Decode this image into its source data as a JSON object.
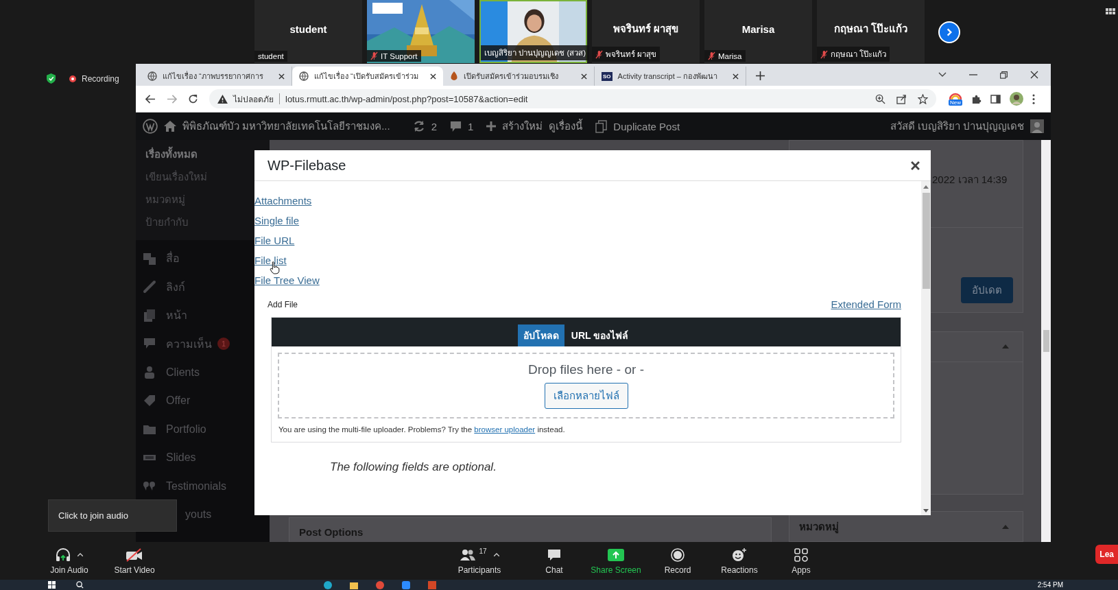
{
  "meeting": {
    "participants": [
      {
        "kind": "name",
        "name": "student",
        "label": "student",
        "muted": false
      },
      {
        "kind": "picture",
        "label": "IT Support",
        "muted": true
      },
      {
        "kind": "video",
        "label": "เบญสิริยา ปานปุญญเดช (สวส)",
        "muted": false
      },
      {
        "kind": "name",
        "name": "พจรินทร์ ผาสุข",
        "label": "พจรินทร์ ผาสุข",
        "muted": true
      },
      {
        "kind": "name",
        "name": "Marisa",
        "label": "Marisa",
        "muted": true
      },
      {
        "kind": "name",
        "name": "กฤษณา โป๊ะแก้ว",
        "label": "กฤษณา โป๊ะแก้ว",
        "muted": true
      }
    ],
    "recording": "Recording",
    "tooltip": "Click to join audio",
    "toolbar": [
      {
        "kind": "audio",
        "label": "Join Audio"
      },
      {
        "kind": "video",
        "label": "Start Video"
      },
      {
        "kind": "participants",
        "label": "Participants",
        "count": "17"
      },
      {
        "kind": "chat",
        "label": "Chat"
      },
      {
        "kind": "share",
        "label": "Share Screen"
      },
      {
        "kind": "record",
        "label": "Record"
      },
      {
        "kind": "reactions",
        "label": "Reactions"
      },
      {
        "kind": "apps",
        "label": "Apps"
      }
    ],
    "leave": "Lea"
  },
  "browser": {
    "tabs": [
      {
        "kind": "globe",
        "title": "แก้ไขเรื่อง “ภาพบรรยากาศการ",
        "selected": false
      },
      {
        "kind": "globe",
        "title": "แก้ไขเรื่อง “เปิดรับสมัครเข้าร่วม",
        "selected": true
      },
      {
        "kind": "drop",
        "title": "เปิดรับสมัครเข้าร่วมอบรมเชิง",
        "selected": false
      },
      {
        "kind": "badge",
        "favicon": "SO",
        "title": "Activity transcript – กองพัฒนา",
        "selected": false
      }
    ],
    "security": "ไม่ปลอดภัย",
    "url": "lotus.rmutt.ac.th/wp-admin/post.php?post=10587&action=edit",
    "extension_badge": "New"
  },
  "admin_bar": {
    "site": "พิพิธภัณฑ์บัว มหาวิทยาลัยเทคโนโลยีราชมงค...",
    "updates": "2",
    "comments": "1",
    "new": "สร้างใหม่",
    "view": "ดูเรื่องนี้",
    "duplicate": "Duplicate Post",
    "greeting": "สวัสดี เบญสิริยา ปานปุญญเดช"
  },
  "sidebar": {
    "submenu": [
      {
        "label": "เรื่องทั้งหมด",
        "selected": true
      },
      {
        "label": "เขียนเรื่องใหม่",
        "selected": false
      },
      {
        "label": "หมวดหมู่",
        "selected": false
      },
      {
        "label": "ป้ายกำกับ",
        "selected": false
      }
    ],
    "menu": [
      {
        "label": "สื่อ"
      },
      {
        "label": "ลิงก์"
      },
      {
        "label": "หน้า"
      },
      {
        "label": "ความเห็น",
        "badge": "1"
      },
      {
        "label": "Clients"
      },
      {
        "label": "Offer"
      },
      {
        "label": "Portfolio"
      },
      {
        "label": "Slides"
      },
      {
        "label": "Testimonials"
      },
      {
        "label": "youts"
      }
    ]
  },
  "editor": {
    "publish_date": "2022 เวลา 14:39",
    "update_button": "อัปเดต",
    "post_options": "Post Options",
    "categories": "หมวดหมู่"
  },
  "modal": {
    "title": "WP-Filebase",
    "links": [
      "Attachments",
      "Single file",
      "File URL",
      "File list",
      "File Tree View"
    ],
    "add_file": "Add File",
    "extended_form": "Extended Form",
    "upload_tabs": [
      {
        "label": "อัปโหลด",
        "selected": true
      },
      {
        "label": "URL ของไฟล์",
        "selected": false
      }
    ],
    "drop_text": "Drop files here - or -",
    "select_button": "เลือกหลายไฟล์",
    "notice": {
      "before": "You are using the multi-file uploader. Problems? Try the",
      "link": "browser uploader",
      "after": "instead."
    },
    "optional_note": "The following fields are optional."
  },
  "taskbar": {
    "time": "2:54 PM"
  }
}
